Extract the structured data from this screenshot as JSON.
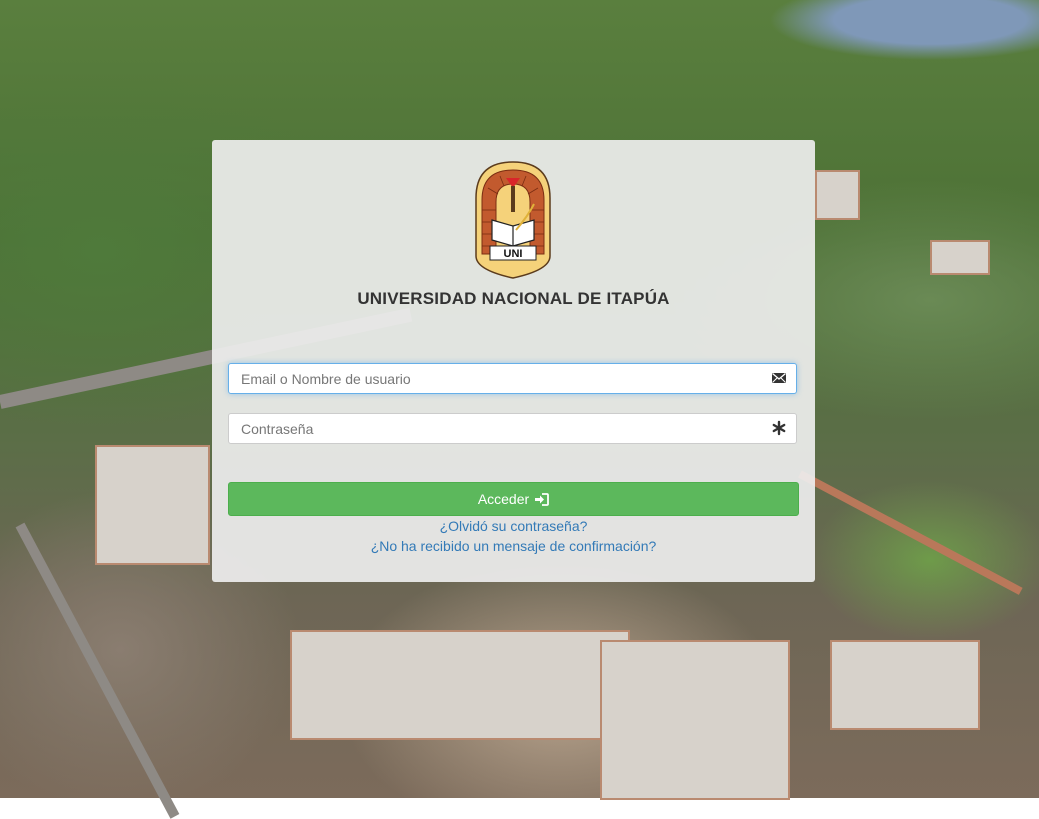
{
  "brand": {
    "logo_text": "UNI",
    "title": "UNIVERSIDAD NACIONAL DE ITAPÚA"
  },
  "login": {
    "username": {
      "placeholder": "Email o Nombre de usuario",
      "value": "",
      "icon": "envelope-icon"
    },
    "password": {
      "placeholder": "Contraseña",
      "value": "",
      "icon": "asterisk-icon"
    },
    "submit_label": "Acceder",
    "submit_icon": "sign-in-icon",
    "forgot_password_link": "¿Olvidó su contraseña?",
    "resend_confirmation_link": "¿No ha recibido un mensaje de confirmación?"
  },
  "colors": {
    "accent_button": "#5cb85c",
    "link": "#337ab7",
    "focus_border": "#66afe9"
  }
}
